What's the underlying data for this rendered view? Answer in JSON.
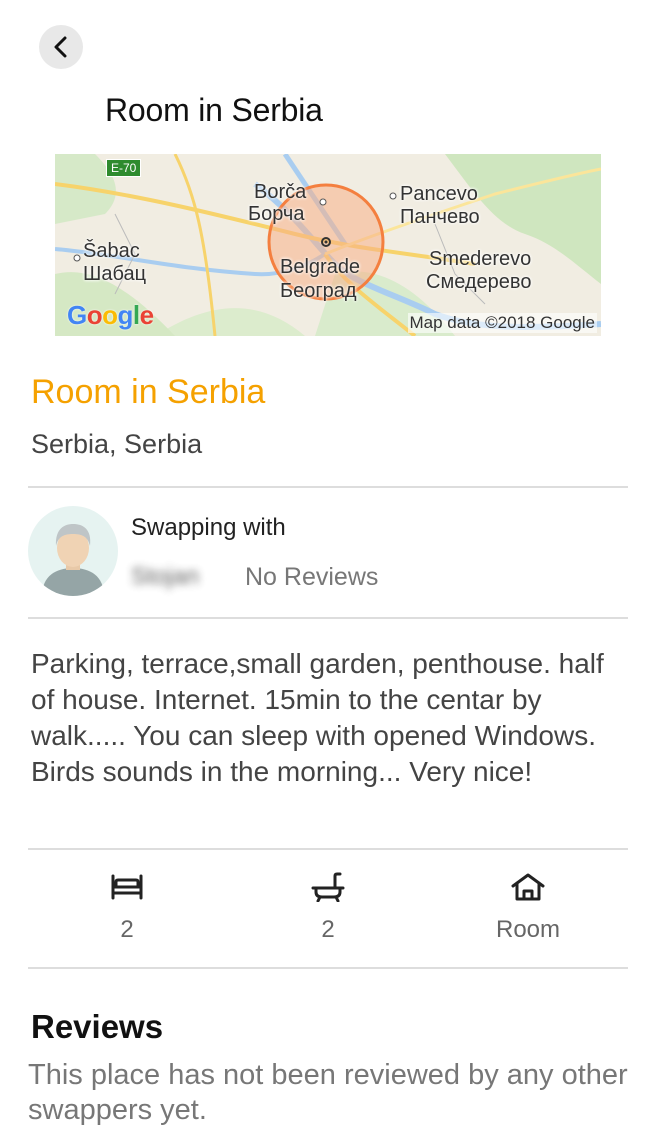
{
  "header": {
    "back_icon": "chevron-left-icon",
    "title": "Room in Serbia"
  },
  "map": {
    "road_badge": "E-70",
    "labels": {
      "borca_latin": "Borča",
      "borca_cyrillic": "Борча",
      "pancevo_latin": "Pancevo",
      "pancevo_cyrillic": "Панчево",
      "sabac_latin": "Šabac",
      "sabac_cyrillic": "Шабац",
      "belgrade_latin": "Belgrade",
      "belgrade_cyrillic": "Београд",
      "smederevo_latin": "Smederevo",
      "smederevo_cyrillic": "Смедерево"
    },
    "logo": "Google",
    "attribution": "Map data ©2018 Google",
    "marker_color": "#f47f3f"
  },
  "listing": {
    "title": "Room in Serbia",
    "location": "Serbia, Serbia",
    "title_color": "#f5a100"
  },
  "host": {
    "swapping_label": "Swapping with",
    "name": "Stojan",
    "reviews": "No Reviews"
  },
  "description": "Parking, terrace,small  garden, penthouse. half of house. Internet. 15min to the centar by walk..... You can sleep with opened Windows. Birds sounds in the morning... Very nice!",
  "amenities": [
    {
      "icon": "bed-icon",
      "value": "2"
    },
    {
      "icon": "bathtub-icon",
      "value": "2"
    },
    {
      "icon": "home-icon",
      "value": "Room"
    }
  ],
  "reviews": {
    "heading": "Reviews",
    "empty_text": "This place has not been reviewed by any other swappers yet."
  }
}
